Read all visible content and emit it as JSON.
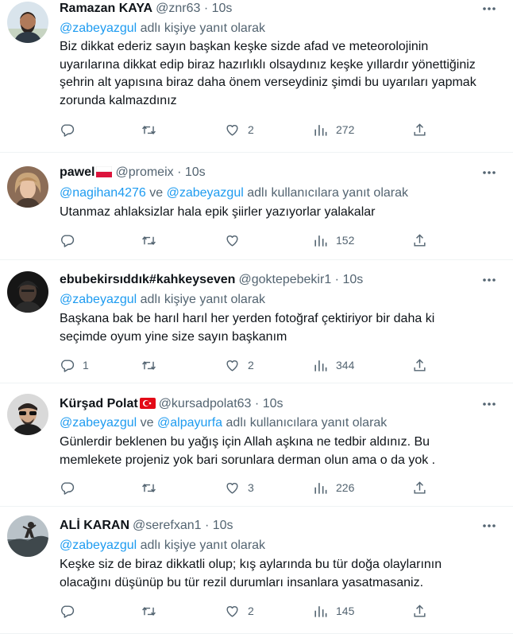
{
  "tweets": [
    {
      "name": "Ramazan KAYA",
      "handle": "@znr63",
      "time": "10s",
      "reply_mentions": [
        "@zabeyazgul"
      ],
      "reply_suffix": "adlı kişiye yanıt olarak",
      "body": [
        "Biz dikkat ederiz sayın başkan keşke sizde afad ve meteorolojinin",
        "uyarılarına dikkat edip biraz hazırlıklı olsaydınız keşke yıllardır yönettiğiniz",
        "şehrin alt yapısına biraz daha önem verseydiniz şimdi bu uyarıları yapmak",
        "zorunda kalmazdınız"
      ],
      "replies": "",
      "retweets": "",
      "likes": "2",
      "views": "272"
    },
    {
      "name": "pawel",
      "flag": "poland",
      "handle": "@promeix",
      "time": "10s",
      "reply_mentions": [
        "@nagihan4276",
        "@zabeyazgul"
      ],
      "reply_suffix": "adlı kullanıcılara yanıt olarak",
      "body": [
        "Utanmaz ahlaksizlar hala epik şiirler yazıyorlar yalakalar"
      ],
      "replies": "",
      "retweets": "",
      "likes": "",
      "views": "152"
    },
    {
      "name": "ebubekirsıddık#kahkeyseven",
      "handle": "@goktepebekir1",
      "time": "10s",
      "reply_mentions": [
        "@zabeyazgul"
      ],
      "reply_suffix": "adlı kişiye yanıt olarak",
      "body": [
        "Başkana bak be harıl harıl her yerden fotoğraf çektiriyor bir daha ki",
        "seçimde oyum yine size sayın başkanım"
      ],
      "replies": "1",
      "retweets": "",
      "likes": "2",
      "views": "344"
    },
    {
      "name": "Kürşad Polat",
      "flag": "turkey",
      "handle": "@kursadpolat63",
      "time": "10s",
      "reply_mentions": [
        "@zabeyazgul",
        "@alpayurfa"
      ],
      "reply_suffix": "adlı kullanıcılara yanıt olarak",
      "body": [
        "Günlerdir beklenen bu yağış için Allah aşkına ne tedbir aldınız. Bu",
        "memlekete projeniz yok bari sorunlara derman olun ama o da yok ."
      ],
      "replies": "",
      "retweets": "",
      "likes": "3",
      "views": "226"
    },
    {
      "name": "ALİ KARAN",
      "handle": "@serefxan1",
      "time": "10s",
      "reply_mentions": [
        "@zabeyazgul"
      ],
      "reply_suffix": "adlı kişiye yanıt olarak",
      "body": [
        "Keşke siz de biraz dikkatli olup; kış aylarında bu tür doğa olaylarının",
        "olacağını düşünüp bu tür rezil durumları insanlara yasatmasaniz."
      ],
      "replies": "",
      "retweets": "",
      "likes": "2",
      "views": "145"
    }
  ],
  "reply_conjunction": "ve",
  "time_separator": "·",
  "colors": {
    "text": "#0f1419",
    "secondary": "#536471",
    "link": "#1d9bf0",
    "divider": "#eff3f4"
  }
}
